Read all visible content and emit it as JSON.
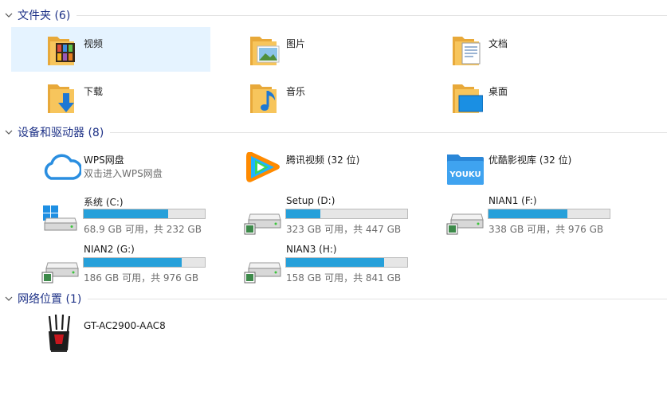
{
  "groups": {
    "folders": {
      "title": "文件夹 (6)"
    },
    "devices": {
      "title": "设备和驱动器 (8)"
    },
    "network": {
      "title": "网络位置 (1)"
    }
  },
  "folders": [
    {
      "label": "视频",
      "icon": "video-folder-icon"
    },
    {
      "label": "图片",
      "icon": "pictures-folder-icon"
    },
    {
      "label": "文档",
      "icon": "documents-folder-icon"
    },
    {
      "label": "下载",
      "icon": "downloads-folder-icon"
    },
    {
      "label": "音乐",
      "icon": "music-folder-icon"
    },
    {
      "label": "桌面",
      "icon": "desktop-folder-icon"
    }
  ],
  "apps": [
    {
      "label": "WPS网盘",
      "sub": "双击进入WPS网盘",
      "icon": "wps-cloud-icon"
    },
    {
      "label": "腾讯视频 (32 位)",
      "icon": "tencent-video-icon"
    },
    {
      "label": "优酷影视库 (32 位)",
      "icon": "youku-icon"
    }
  ],
  "drives": [
    {
      "label": "系统 (C:)",
      "usage": "68.9 GB 可用，共 232 GB",
      "used_fraction": 0.7,
      "icon": "system-drive-icon"
    },
    {
      "label": "Setup (D:)",
      "usage": "323 GB 可用，共 447 GB",
      "used_fraction": 0.28,
      "icon": "hard-drive-icon"
    },
    {
      "label": "NIAN1 (F:)",
      "usage": "338 GB 可用，共 976 GB",
      "used_fraction": 0.65,
      "icon": "hard-drive-icon"
    },
    {
      "label": "NIAN2 (G:)",
      "usage": "186 GB 可用，共 976 GB",
      "used_fraction": 0.81,
      "icon": "hard-drive-icon"
    },
    {
      "label": "NIAN3 (H:)",
      "usage": "158 GB 可用，共 841 GB",
      "used_fraction": 0.81,
      "icon": "hard-drive-icon"
    }
  ],
  "network": [
    {
      "label": "GT-AC2900-AAC8",
      "icon": "router-icon"
    }
  ],
  "colors": {
    "header_text": "#1e3287",
    "selection": "#e5f3ff",
    "bar_fill": "#26a0da",
    "bar_track": "#e6e6e6",
    "folder": "#f7c55c"
  }
}
